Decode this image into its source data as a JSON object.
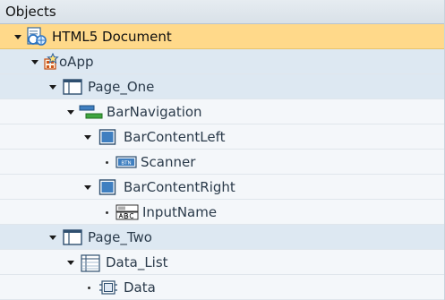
{
  "header": {
    "title": "Objects"
  },
  "tree": [
    {
      "label": "HTML5 Document",
      "icon": "html5-document-icon",
      "expanded": true
    },
    {
      "label": "oApp",
      "icon": "app-object-icon",
      "expanded": true
    },
    {
      "label": "Page_One",
      "icon": "page-icon",
      "expanded": true
    },
    {
      "label": "BarNavigation",
      "icon": "bar-navigation-icon",
      "expanded": true
    },
    {
      "label": "BarContentLeft",
      "icon": "container-icon",
      "expanded": true
    },
    {
      "label": "Scanner",
      "icon": "button-control-icon",
      "leaf": true
    },
    {
      "label": "BarContentRight",
      "icon": "container-icon",
      "expanded": true
    },
    {
      "label": "InputName",
      "icon": "input-field-icon",
      "leaf": true
    },
    {
      "label": "Page_Two",
      "icon": "page-icon",
      "expanded": true
    },
    {
      "label": "Data_List",
      "icon": "list-icon",
      "expanded": true
    },
    {
      "label": "Data",
      "icon": "data-item-icon",
      "leaf": true
    }
  ],
  "colors": {
    "selected_row": "#ffd98a",
    "alt_row": "#dde8f2",
    "header": "#d9e1e8"
  }
}
